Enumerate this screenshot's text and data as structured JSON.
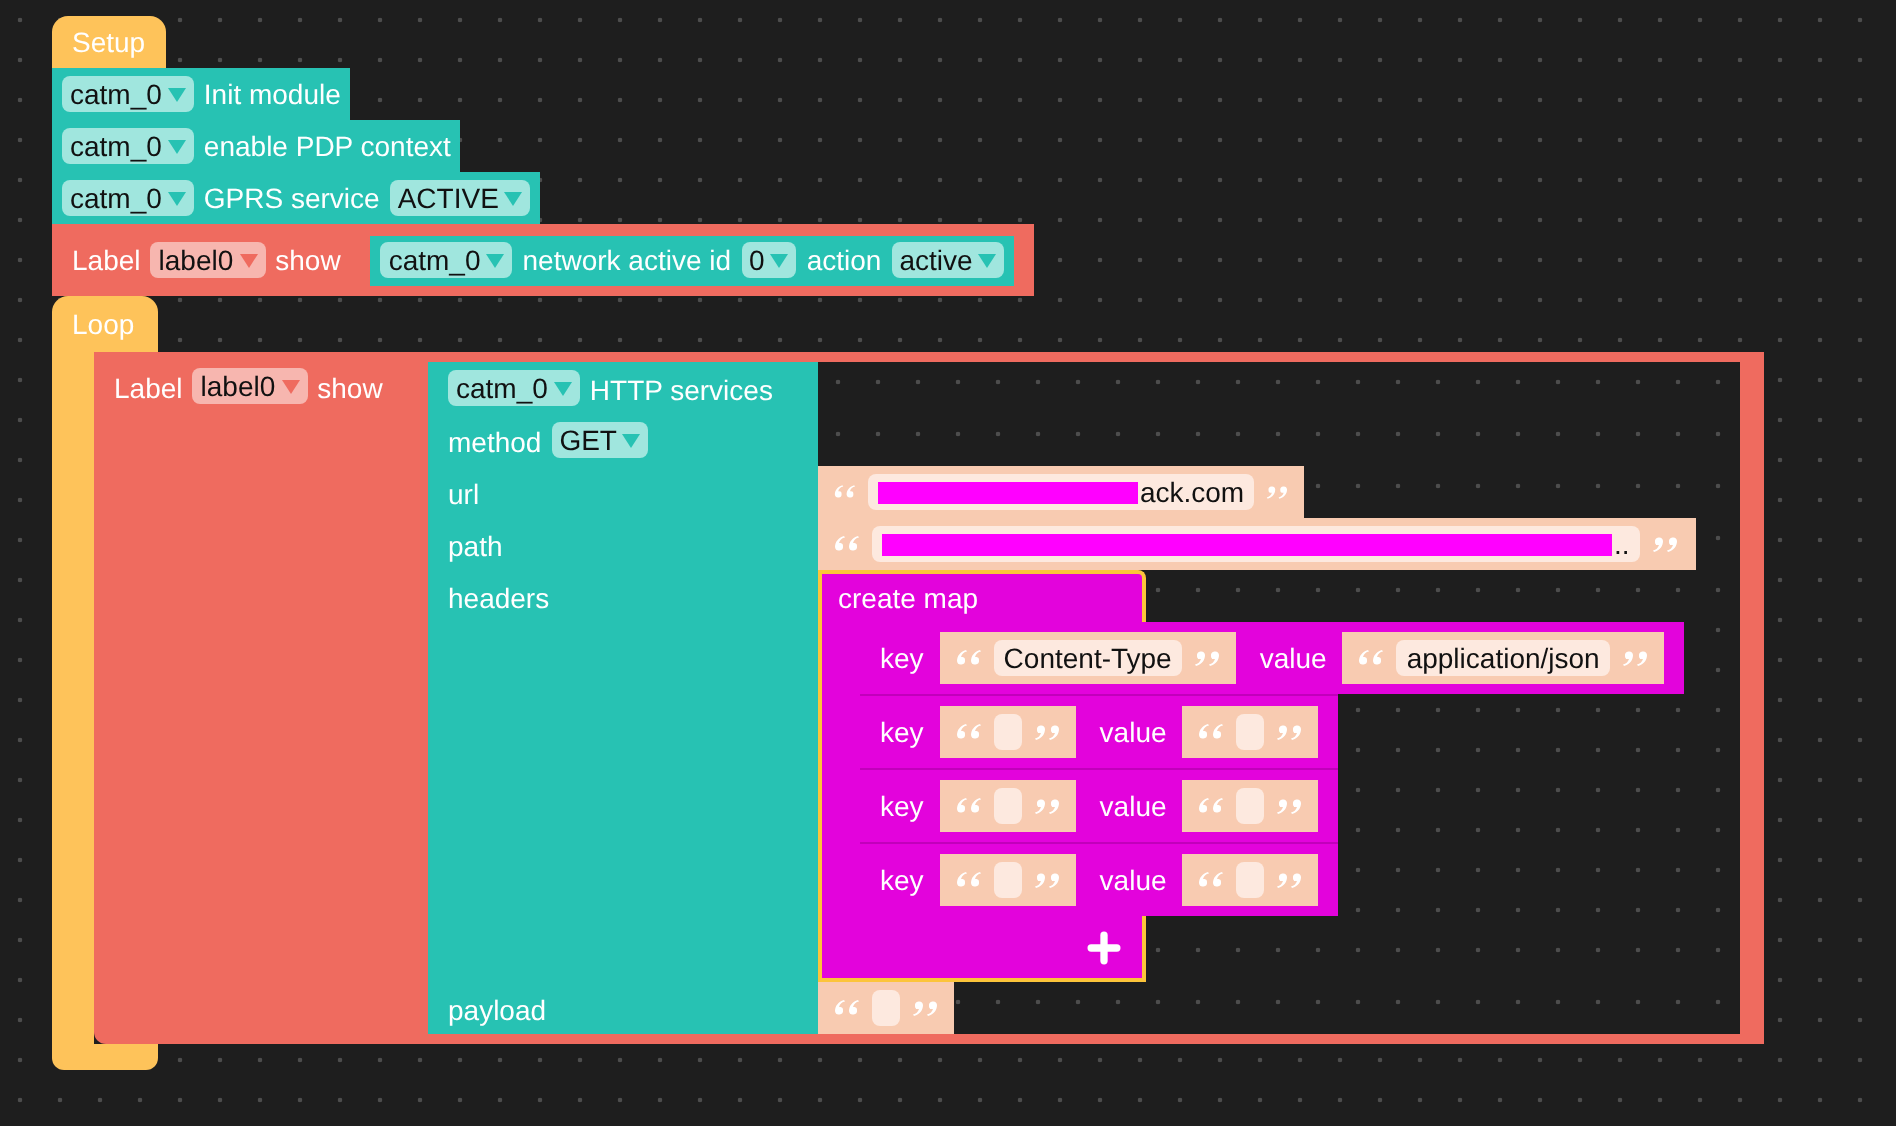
{
  "setup": {
    "title": "Setup",
    "blocks": [
      {
        "kind": "module",
        "parts": [
          {
            "kind": "dropdown",
            "text": "catm_0"
          },
          {
            "kind": "text",
            "text": "Init module"
          }
        ]
      },
      {
        "kind": "module",
        "parts": [
          {
            "kind": "dropdown",
            "text": "catm_0"
          },
          {
            "kind": "text",
            "text": "enable PDP context"
          }
        ]
      },
      {
        "kind": "module",
        "parts": [
          {
            "kind": "dropdown",
            "text": "catm_0"
          },
          {
            "kind": "text",
            "text": "GPRS service"
          },
          {
            "kind": "dropdown",
            "text": "ACTIVE"
          }
        ]
      },
      {
        "kind": "label",
        "parts": [
          {
            "kind": "text",
            "text": "Label"
          },
          {
            "kind": "dropdown",
            "text": "label0"
          },
          {
            "kind": "text",
            "text": "show"
          },
          {
            "kind": "module_block",
            "parts": [
              {
                "kind": "dropdown",
                "text": "catm_0"
              },
              {
                "kind": "text",
                "text": "network active id"
              },
              {
                "kind": "dropdown",
                "text": "0"
              },
              {
                "kind": "text",
                "text": "action"
              },
              {
                "kind": "dropdown",
                "text": "active"
              }
            ]
          }
        ]
      }
    ]
  },
  "loop": {
    "title": "Loop",
    "label": {
      "kind": "label",
      "parts": [
        {
          "kind": "text",
          "text": "Label"
        },
        {
          "kind": "dropdown",
          "text": "label0"
        },
        {
          "kind": "text",
          "text": "show"
        }
      ]
    },
    "http": {
      "header": [
        {
          "kind": "dropdown",
          "text": "catm_0"
        },
        {
          "kind": "text",
          "text": "HTTP services"
        }
      ],
      "method": {
        "label": "method",
        "value": "GET"
      },
      "url": {
        "label": "url",
        "text": "ack.com",
        "redacted": true
      },
      "path": {
        "label": "path",
        "text": "..",
        "redacted": true
      },
      "headers": {
        "label": "headers",
        "map": {
          "title": "create map",
          "selected": true,
          "entries": [
            {
              "key_label": "key",
              "key": "Content-Type",
              "value_label": "value",
              "value": "application/json"
            },
            {
              "key_label": "key",
              "value_label": "value"
            },
            {
              "key_label": "key",
              "value_label": "value"
            },
            {
              "key_label": "key",
              "value_label": "value"
            }
          ]
        }
      },
      "payload": {
        "label": "payload"
      }
    }
  }
}
